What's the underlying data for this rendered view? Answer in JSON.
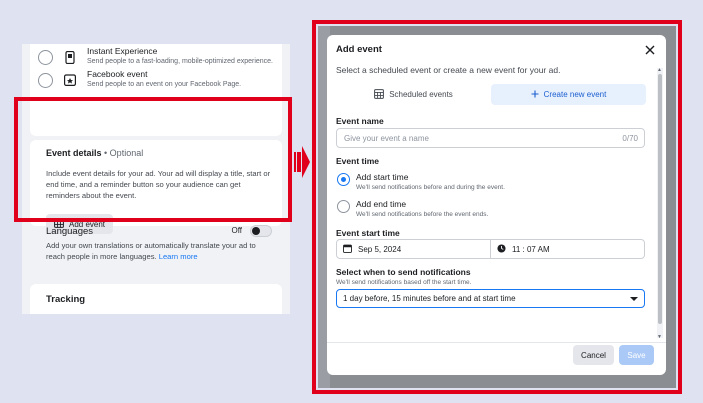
{
  "left": {
    "options": [
      {
        "title": "Instant Experience",
        "desc": "Send people to a fast-loading, mobile-optimized experience.",
        "icon": "instant-experience-icon"
      },
      {
        "title": "Facebook event",
        "desc": "Send people to an event on your Facebook Page.",
        "icon": "facebook-event-icon"
      }
    ],
    "event_details": {
      "title": "Event details",
      "optional": " • Optional",
      "desc": "Include event details for your ad. Your ad will display a title, start or end time, and a reminder button so your audience can get reminders about the event.",
      "add_button": "Add event"
    },
    "languages": {
      "title": "Languages",
      "toggle_label": "Off",
      "desc": "Add your own translations or automatically translate your ad to reach people in more languages.",
      "link": "Learn more"
    },
    "tracking": {
      "title": "Tracking"
    }
  },
  "modal": {
    "title": "Add event",
    "subtitle": "Select a scheduled event or create a new event for your ad.",
    "tabs": [
      {
        "label": "Scheduled events",
        "icon": "calendar-icon"
      },
      {
        "label": "Create new event",
        "icon": "plus-icon",
        "active": true
      }
    ],
    "event_name": {
      "label": "Event name",
      "placeholder": "Give your event a name",
      "count": "0/70"
    },
    "event_time": {
      "label": "Event time",
      "options": [
        {
          "title": "Add start time",
          "desc": "We'll send notifications before and during the event.",
          "selected": true
        },
        {
          "title": "Add end time",
          "desc": "We'll send notifications before the event ends.",
          "selected": false
        }
      ]
    },
    "start_time": {
      "label": "Event start time",
      "date": "Sep 5, 2024",
      "time": "11 : 07 AM"
    },
    "notifications": {
      "label": "Select when to send notifications",
      "desc": "We'll send notifications based off the start time.",
      "selected": "1 day before, 15 minutes before and at start time"
    },
    "buttons": {
      "cancel": "Cancel",
      "save": "Save"
    }
  },
  "colors": {
    "highlight": "#e0001b",
    "accent": "#1877f2",
    "save_disabled": "#aac9f6"
  }
}
